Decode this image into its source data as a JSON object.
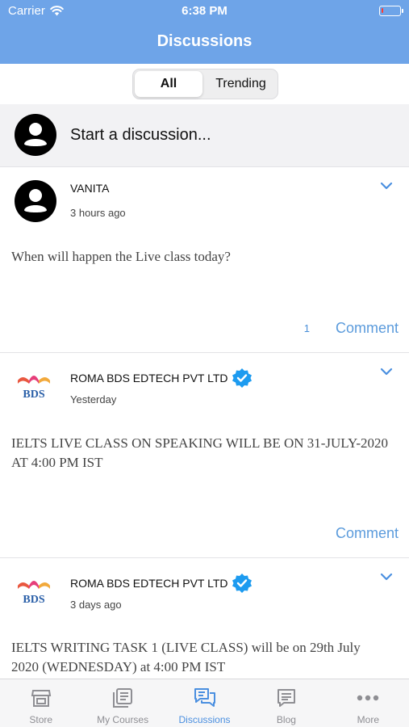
{
  "status_bar": {
    "carrier": "Carrier",
    "time": "6:38 PM",
    "battery_level": 0.1
  },
  "header": {
    "title": "Discussions"
  },
  "segments": {
    "active": "All",
    "inactive": "Trending"
  },
  "start_discussion": {
    "placeholder": "Start a discussion..."
  },
  "posts": [
    {
      "author": "VANITA",
      "time": "3 hours ago",
      "body": "When will happen the Live class today?",
      "comment_count": "1",
      "comment_label": "Comment"
    },
    {
      "author": "ROMA BDS EDTECH PVT LTD",
      "time": "Yesterday",
      "body": "IELTS LIVE CLASS ON SPEAKING WILL BE ON 31-JULY-2020 AT 4:00 PM IST",
      "comment_label": "Comment",
      "logo_text": "BDS"
    },
    {
      "author": "ROMA BDS EDTECH PVT LTD",
      "time": "3 days ago",
      "body": "IELTS WRITING TASK 1 (LIVE CLASS) will be on 29th July 2020 (WEDNESDAY) at 4:00 PM IST",
      "logo_text": "BDS"
    }
  ],
  "tabbar": {
    "items": [
      {
        "label": "Store",
        "icon": "store-icon"
      },
      {
        "label": "My Courses",
        "icon": "courses-icon"
      },
      {
        "label": "Discussions",
        "icon": "discussions-icon",
        "active": true
      },
      {
        "label": "Blog",
        "icon": "blog-icon"
      },
      {
        "label": "More",
        "icon": "more-icon"
      }
    ]
  },
  "colors": {
    "header": "#6ea4e8",
    "accent": "#4a8fe0",
    "verified": "#1d9bf0",
    "battery_low": "#ff3b30"
  }
}
